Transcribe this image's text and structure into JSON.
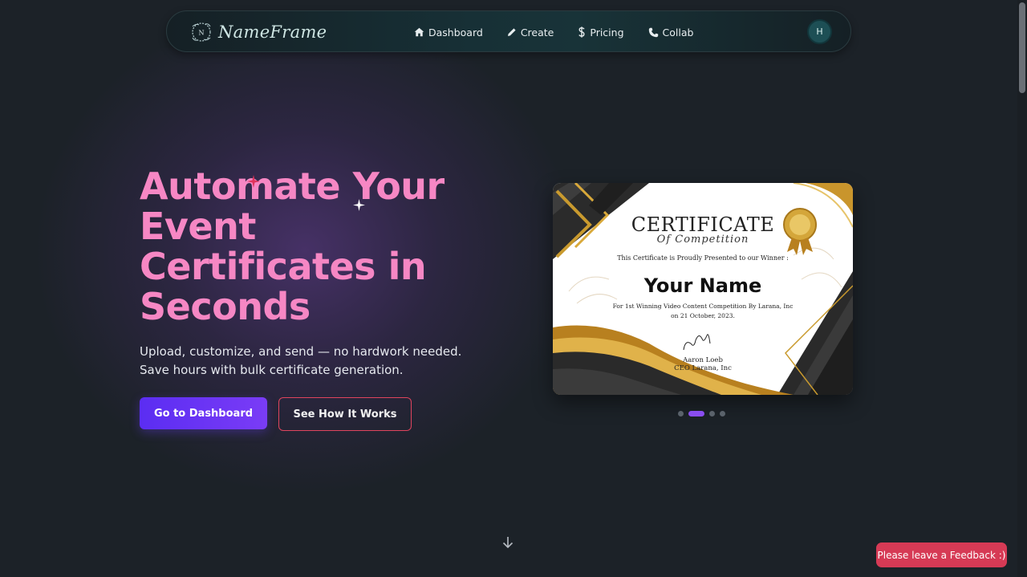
{
  "nav": {
    "brand": "NameFrame",
    "items": [
      {
        "label": "Dashboard",
        "icon": "home-icon"
      },
      {
        "label": "Create",
        "icon": "pencil-icon"
      },
      {
        "label": "Pricing",
        "icon": "dollar-icon"
      },
      {
        "label": "Collab",
        "icon": "phone-icon"
      }
    ],
    "avatar_initial": "H"
  },
  "hero": {
    "title_line1": "Automate Your",
    "title_line2": "Event",
    "title_line3": "Certificates in",
    "title_line4": "Seconds",
    "subtitle_line1": "Upload, customize, and send — no hardwork needed.",
    "subtitle_line2": "Save hours with bulk certificate generation.",
    "primary_button": "Go to Dashboard",
    "secondary_button": "See How It Works"
  },
  "certificate": {
    "title": "CERTIFICATE",
    "subtitle": "Of Competition",
    "presented": "This Certificate is Proudly Presented to our Winner :",
    "name": "Your Name",
    "description_line1": "For 1st Winning Video Content Competition By Larana, Inc",
    "description_line2": "on 21 October, 2023.",
    "signer_name": "Aaron Loeb",
    "signer_title": "CEO Larana, Inc"
  },
  "carousel": {
    "slide_count": 4,
    "active_index": 1
  },
  "feedback_button": "Please leave a Feedback :)",
  "colors": {
    "background": "#1c2228",
    "accent_pink": "#f687c4",
    "primary_purple": "#6b35f4",
    "feedback_red": "#d63a55"
  }
}
